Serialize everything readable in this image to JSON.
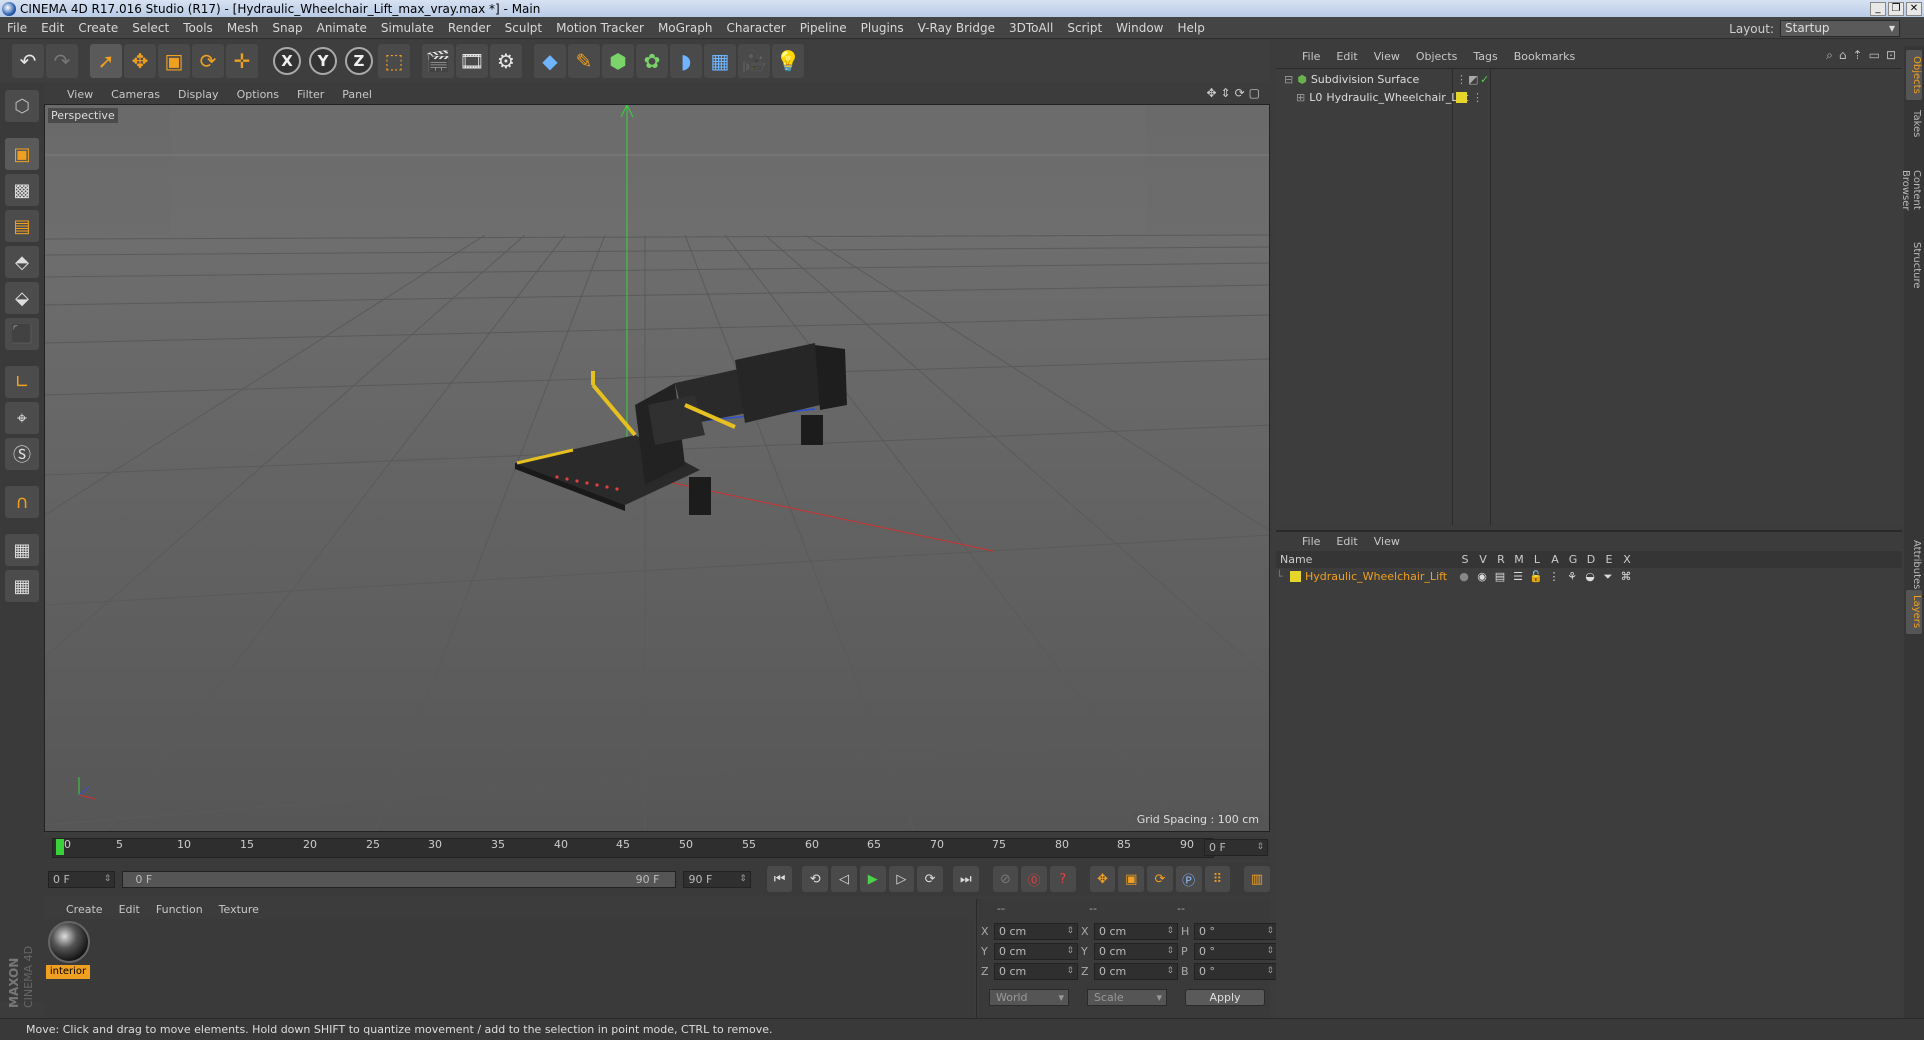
{
  "window": {
    "title": "CINEMA 4D R17.016 Studio (R17) - [Hydraulic_Wheelchair_Lift_max_vray.max *] - Main",
    "controls": [
      "_",
      "❐",
      "✕"
    ]
  },
  "menubar": {
    "items": [
      "File",
      "Edit",
      "Create",
      "Select",
      "Tools",
      "Mesh",
      "Snap",
      "Animate",
      "Simulate",
      "Render",
      "Sculpt",
      "Motion Tracker",
      "MoGraph",
      "Character",
      "Pipeline",
      "Plugins",
      "V-Ray Bridge",
      "3DToAll",
      "Script",
      "Window",
      "Help"
    ],
    "layout_label": "Layout:",
    "layout_value": "Startup"
  },
  "toolbar": {
    "axis_x": "X",
    "axis_y": "Y",
    "axis_z": "Z",
    "icons": [
      "undo-icon",
      "redo-icon",
      "select-icon",
      "move-icon",
      "scale-icon",
      "rotate-icon",
      "live-selection-icon",
      "x-axis-icon",
      "y-axis-icon",
      "z-axis-icon",
      "coordinate-system-icon",
      "render-view-icon",
      "render-picture-viewer-icon",
      "edit-render-settings-icon",
      "cube-icon",
      "pen-icon",
      "subdivision-icon",
      "cloner-icon",
      "deformer-icon",
      "floor-icon",
      "camera-icon",
      "light-icon"
    ]
  },
  "viewport": {
    "menu": [
      "View",
      "Cameras",
      "Display",
      "Options",
      "Filter",
      "Panel"
    ],
    "label": "Perspective",
    "grid_spacing": "Grid Spacing : 100 cm"
  },
  "timeline": {
    "ticks": [
      "0",
      "5",
      "10",
      "15",
      "20",
      "25",
      "30",
      "35",
      "40",
      "45",
      "50",
      "55",
      "60",
      "65",
      "70",
      "75",
      "80",
      "85",
      "90"
    ],
    "current_frame_field": "0 F",
    "start_field": "0 F",
    "range_start": "0 F",
    "range_end": "90 F",
    "end_field": "90 F"
  },
  "materials": {
    "menu": [
      "Create",
      "Edit",
      "Function",
      "Texture"
    ],
    "items": [
      {
        "name": "interior"
      }
    ]
  },
  "coordinates": {
    "headers": [
      "--",
      "--",
      "--"
    ],
    "rows": [
      {
        "a": "X",
        "av": "0 cm",
        "b": "X",
        "bv": "0 cm",
        "c": "H",
        "cv": "0 °"
      },
      {
        "a": "Y",
        "av": "0 cm",
        "b": "Y",
        "bv": "0 cm",
        "c": "P",
        "cv": "0 °"
      },
      {
        "a": "Z",
        "av": "0 cm",
        "b": "Z",
        "bv": "0 cm",
        "c": "B",
        "cv": "0 °"
      }
    ],
    "mode": "World",
    "scale": "Scale",
    "apply": "Apply"
  },
  "object_manager": {
    "menu": [
      "File",
      "Edit",
      "View",
      "Objects",
      "Tags",
      "Bookmarks"
    ],
    "objects": [
      {
        "name": "Subdivision Surface",
        "color": "#6ab04c"
      },
      {
        "name": "Hydraulic_Wheelchair_Lift",
        "color": "#e6d52a"
      }
    ]
  },
  "layer_manager": {
    "menu": [
      "File",
      "Edit",
      "View"
    ],
    "header_name": "Name",
    "columns": [
      "S",
      "V",
      "R",
      "M",
      "L",
      "A",
      "G",
      "D",
      "E",
      "X"
    ],
    "layers": [
      {
        "name": "Hydraulic_Wheelchair_Lift",
        "color": "#e6d52a"
      }
    ]
  },
  "side_tabs": [
    "Objects",
    "Takes",
    "Content Browser",
    "Structure",
    "Attributes",
    "Layers"
  ],
  "status": {
    "text": "Move: Click and drag to move elements. Hold down SHIFT to quantize movement / add to the selection in point mode, CTRL to remove."
  },
  "branding": {
    "maxon": "MAXON",
    "product": "CINEMA 4D"
  },
  "colors": {
    "accent": "#f0a020",
    "selected_text": "#f0a020",
    "y_axis": "#3ad13a",
    "x_axis": "#d03030",
    "z_axis": "#3050d0"
  }
}
